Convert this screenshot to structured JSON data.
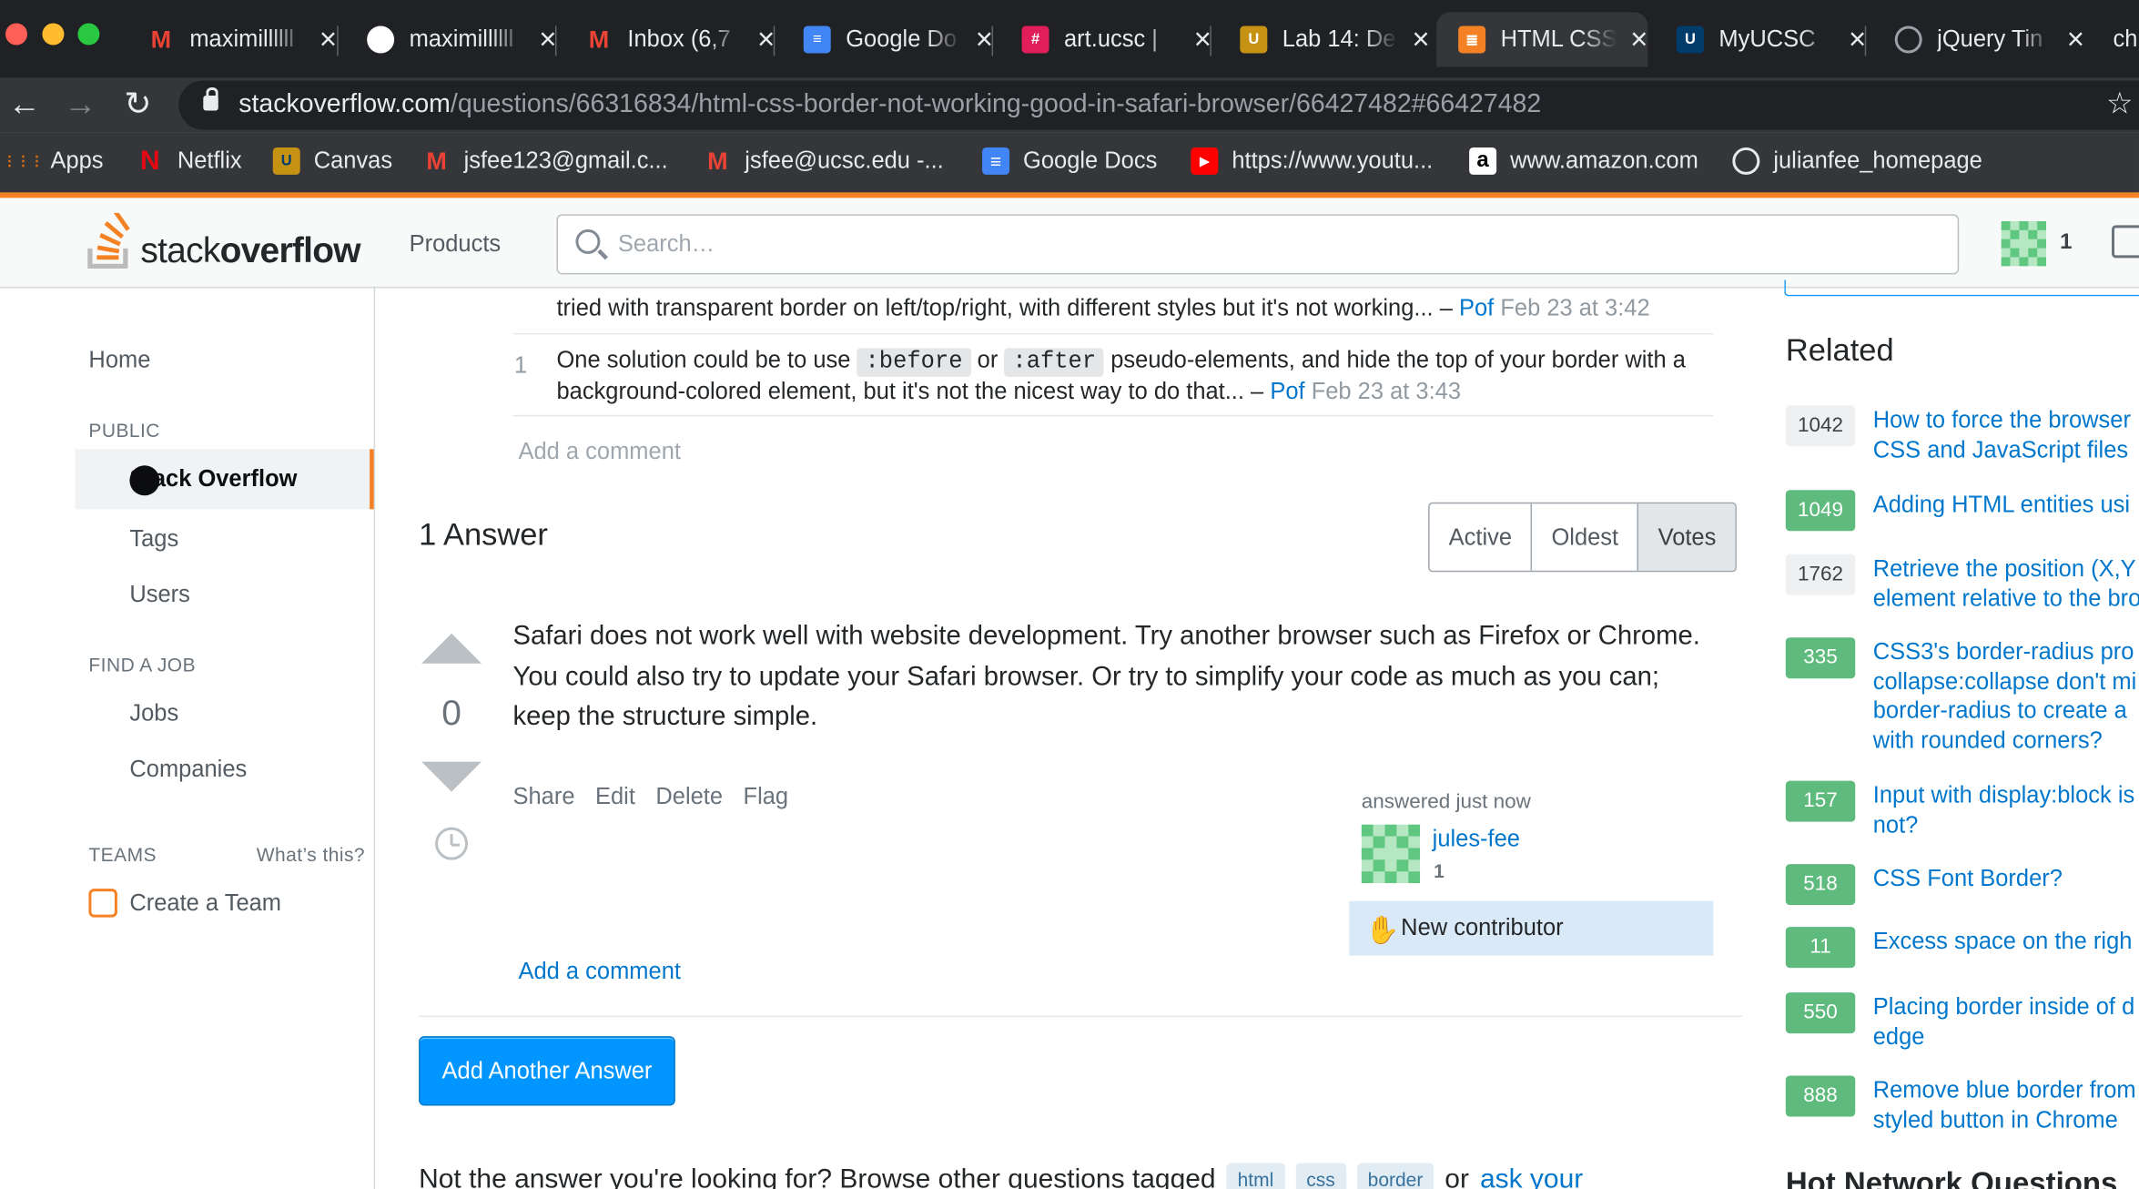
{
  "browser": {
    "tabs": [
      {
        "title": "maximillllll",
        "icon": "gmail-icon",
        "color": "#EA4335",
        "fav": "M"
      },
      {
        "title": "maximillllll",
        "icon": "github-icon",
        "color": "#ffffff",
        "fav": ""
      },
      {
        "title": "Inbox (6,7",
        "icon": "gmail-icon",
        "color": "#EA4335",
        "fav": "M"
      },
      {
        "title": "Google Do",
        "icon": "google-docs-icon",
        "color": "#4285F4",
        "fav": "≡"
      },
      {
        "title": "art.ucsc |",
        "icon": "slack-icon",
        "color": "#E01E5A",
        "fav": "#"
      },
      {
        "title": "Lab 14: De",
        "icon": "ucsc-icon",
        "color": "#C69214",
        "fav": "U"
      },
      {
        "title": "HTML CSS",
        "icon": "stackoverflow-icon",
        "color": "#F48225",
        "fav": "≣"
      },
      {
        "title": "MyUCSC",
        "icon": "ucsc-icon",
        "color": "#003C6C",
        "fav": "U"
      },
      {
        "title": "jQuery Tin",
        "icon": "globe-icon",
        "color": "#9aa0a6",
        "fav": ""
      },
      {
        "title": "ch",
        "icon": "",
        "color": "",
        "fav": ""
      }
    ],
    "url_host": "stackoverflow.com",
    "url_path": "/questions/66316834/html-css-border-not-working-good-in-safari-browser/66427482#66427482",
    "bookmarks": [
      {
        "label": "Apps",
        "icon": "apps-grid-icon"
      },
      {
        "label": "Netflix",
        "icon": "netflix-icon"
      },
      {
        "label": "Canvas",
        "icon": "ucsc-icon"
      },
      {
        "label": "jsfee123@gmail.c...",
        "icon": "gmail-icon"
      },
      {
        "label": "jsfee@ucsc.edu -...",
        "icon": "gmail-icon"
      },
      {
        "label": "Google Docs",
        "icon": "google-docs-icon"
      },
      {
        "label": "https://www.youtu...",
        "icon": "youtube-icon"
      },
      {
        "label": "www.amazon.com",
        "icon": "amazon-icon"
      },
      {
        "label": "julianfee_homepage",
        "icon": "globe-icon"
      }
    ]
  },
  "header": {
    "logo_light": "stack",
    "logo_bold": "overflow",
    "products": "Products",
    "search_placeholder": "Search…",
    "reputation": "1"
  },
  "leftnav": {
    "home": "Home",
    "public": "PUBLIC",
    "stackoverflow": "Stack Overflow",
    "tags": "Tags",
    "users": "Users",
    "find_job": "FIND A JOB",
    "jobs": "Jobs",
    "companies": "Companies",
    "teams": "TEAMS",
    "whats_this": "What’s this?",
    "create_team": "Create a Team"
  },
  "comments": [
    {
      "score": "",
      "text": "tried with transparent border on left/top/right, with different styles but it's not working... –",
      "author": "Pof",
      "time": "Feb 23 at 3:42"
    },
    {
      "score": "1",
      "text_a": "One solution could be to use",
      "code_a": ":before",
      "text_b": "or",
      "code_b": ":after",
      "text_c": "pseudo-elements, and hide the top of your border with a background-colored element, but it's not the nicest way to do that... –",
      "author": "Pof",
      "time": "Feb 23 at 3:43"
    }
  ],
  "add_comment_q": "Add a comment",
  "answers": {
    "heading": "1 Answer",
    "sort": [
      "Active",
      "Oldest",
      "Votes"
    ],
    "selected_sort": "Votes"
  },
  "answer": {
    "votes": "0",
    "body": "Safari does not work well with website development. Try another browser such as Firefox or Chrome. You could also try to update your Safari browser. Or try to simplify your code as much as you can; keep the structure simple.",
    "actions": [
      "Share",
      "Edit",
      "Delete",
      "Flag"
    ],
    "answered": "answered just now",
    "user": "jules-fee",
    "user_rep": "1",
    "new_contributor": "New contributor",
    "add_comment": "Add a comment"
  },
  "add_another_answer": "Add Another Answer",
  "bottom": {
    "text": "Not the answer you're looking for? Browse other questions tagged",
    "tags": [
      "html",
      "css",
      "border"
    ],
    "or": "or",
    "ask": "ask your"
  },
  "related": {
    "heading": "Related",
    "items": [
      {
        "count": "1042",
        "accepted": false,
        "title": "How to force the browser\nCSS and JavaScript files"
      },
      {
        "count": "1049",
        "accepted": true,
        "title": "Adding HTML entities usi"
      },
      {
        "count": "1762",
        "accepted": false,
        "title": "Retrieve the position (X,Y\nelement relative to the bro"
      },
      {
        "count": "335",
        "accepted": true,
        "title": "CSS3's border-radius pro\ncollapse:collapse don't mi\nborder-radius to create a\nwith rounded corners?"
      },
      {
        "count": "157",
        "accepted": true,
        "title": "Input with display:block is\nnot?"
      },
      {
        "count": "518",
        "accepted": true,
        "title": "CSS Font Border?"
      },
      {
        "count": "11",
        "accepted": true,
        "title": "Excess space on the righ"
      },
      {
        "count": "550",
        "accepted": true,
        "title": "Placing border inside of d\nedge"
      },
      {
        "count": "888",
        "accepted": true,
        "title": "Remove blue border from\nstyled button in Chrome"
      }
    ],
    "hot_network": "Hot Network Questions"
  }
}
